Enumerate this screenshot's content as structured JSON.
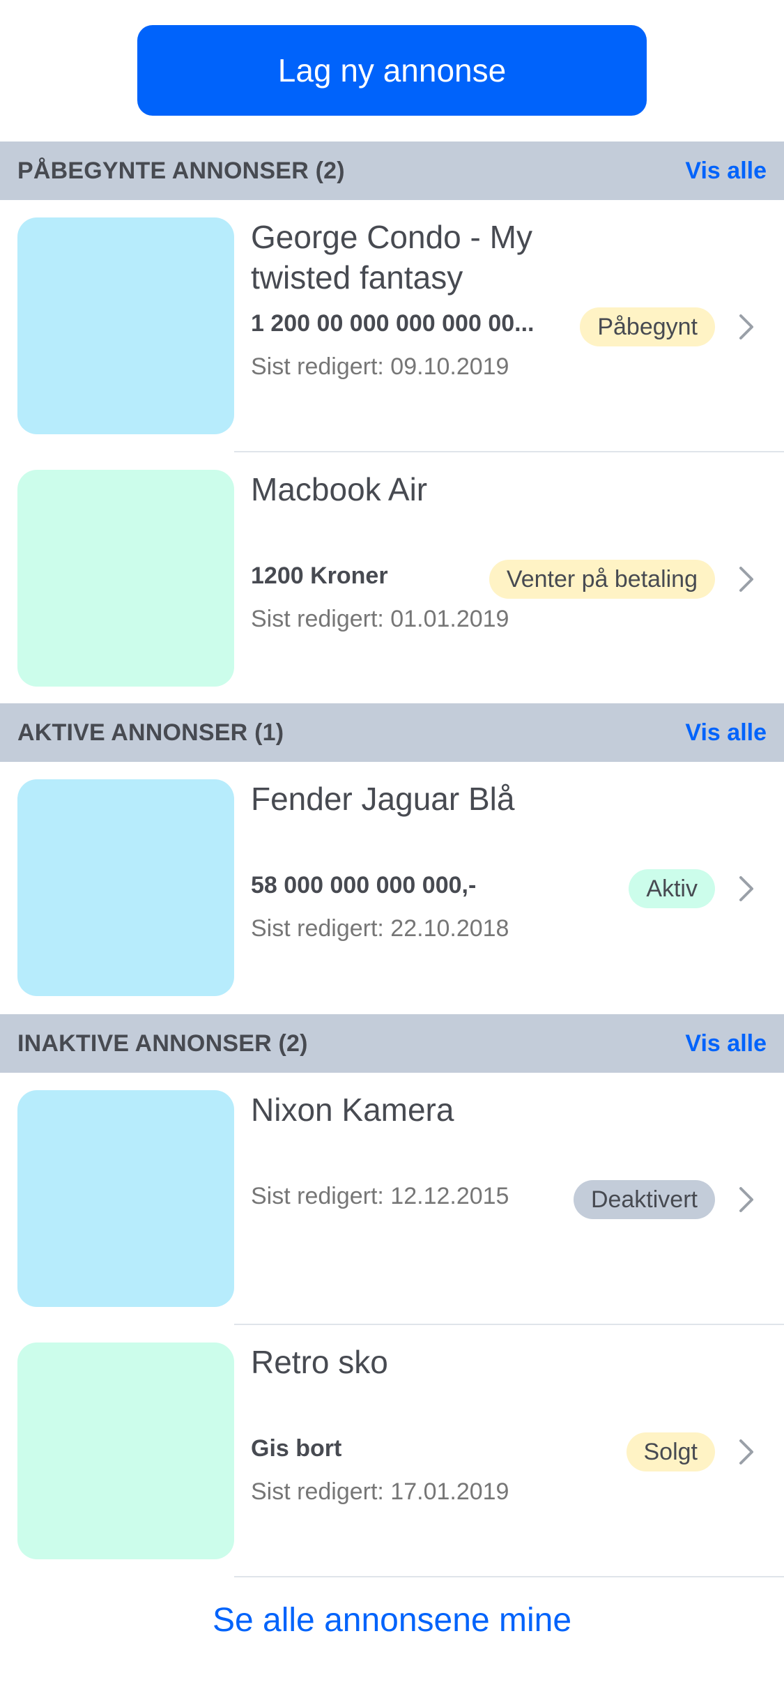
{
  "actions": {
    "new_ad_label": "Lag ny annonse",
    "see_all_label": "Se alle annonsene mine"
  },
  "sections": [
    {
      "title": "PÅBEGYNTE ANNONSER (2)",
      "link": "Vis alle",
      "items": [
        {
          "title": "George Condo - My twisted fantasy",
          "price": "1 200 00 000 000 000 00...",
          "edited": "Sist redigert: 09.10.2019",
          "status": "Påbegynt",
          "status_color": "#fff3c5",
          "thumb_color": "#b7ecfc"
        },
        {
          "title": "Macbook Air",
          "price": "1200 Kroner",
          "edited": "Sist redigert: 01.01.2019",
          "status": "Venter på betaling",
          "status_color": "#fff3c5",
          "thumb_color": "#ccfdeb"
        }
      ]
    },
    {
      "title": "AKTIVE ANNONSER (1)",
      "link": "Vis alle",
      "items": [
        {
          "title": "Fender Jaguar Blå",
          "price": "58 000 000 000 000,-",
          "edited": "Sist redigert: 22.10.2018",
          "status": "Aktiv",
          "status_color": "#ccfdeb",
          "thumb_color": "#b7ecfc"
        }
      ]
    },
    {
      "title": "INAKTIVE ANNONSER (2)",
      "link": "Vis alle",
      "items": [
        {
          "title": "Nixon Kamera",
          "price": "",
          "edited": "Sist redigert: 12.12.2015",
          "status": "Deaktivert",
          "status_color": "#c3ccd9",
          "thumb_color": "#b7ecfc"
        },
        {
          "title": "Retro sko",
          "price": "Gis bort",
          "edited": "Sist redigert: 17.01.2019",
          "status": "Solgt",
          "status_color": "#fff3c5",
          "thumb_color": "#ccfdeb"
        }
      ]
    }
  ],
  "colors": {
    "primary": "#0063fb",
    "section_bg": "#c3ccd9",
    "text": "#474a51",
    "muted": "#767676"
  },
  "icons": {
    "row_arrow": "chevron-right-icon"
  }
}
